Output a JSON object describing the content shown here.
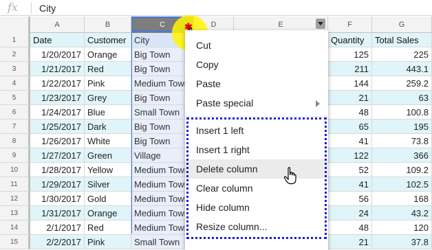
{
  "formula_bar": {
    "fx_label": "fx",
    "value": "City"
  },
  "columns": [
    {
      "letter": "A"
    },
    {
      "letter": "B"
    },
    {
      "letter": "C"
    },
    {
      "letter": "D"
    },
    {
      "letter": "E"
    },
    {
      "letter": "F"
    },
    {
      "letter": "G"
    }
  ],
  "header_row": {
    "number": "1",
    "cells": [
      "Date",
      "Customer",
      "City",
      "Quantity",
      "Total Sales"
    ]
  },
  "rows": [
    {
      "number": "2",
      "date": "1/20/2017",
      "customer": "Orange",
      "city": "Big Town",
      "quantity": "125",
      "total": "225"
    },
    {
      "number": "3",
      "date": "1/21/2017",
      "customer": "Red",
      "city": "Big Town",
      "quantity": "211",
      "total": "443.1"
    },
    {
      "number": "4",
      "date": "1/22/2017",
      "customer": "Pink",
      "city": "Medium Town",
      "quantity": "144",
      "total": "259.2"
    },
    {
      "number": "5",
      "date": "1/23/2017",
      "customer": "Grey",
      "city": "Big Town",
      "quantity": "21",
      "total": "63"
    },
    {
      "number": "6",
      "date": "1/24/2017",
      "customer": "Blue",
      "city": "Small Town",
      "quantity": "48",
      "total": "100.8"
    },
    {
      "number": "7",
      "date": "1/25/2017",
      "customer": "Dark",
      "city": "Big Town",
      "quantity": "65",
      "total": "195"
    },
    {
      "number": "8",
      "date": "1/26/2017",
      "customer": "White",
      "city": "Big Town",
      "quantity": "41",
      "total": "73.8"
    },
    {
      "number": "9",
      "date": "1/27/2017",
      "customer": "Green",
      "city": "Village",
      "quantity": "122",
      "total": "366"
    },
    {
      "number": "10",
      "date": "1/28/2017",
      "customer": "Yellow",
      "city": "Medium Town",
      "quantity": "52",
      "total": "109.2"
    },
    {
      "number": "11",
      "date": "1/29/2017",
      "customer": "Silver",
      "city": "Medium Town",
      "quantity": "41",
      "total": "102.5"
    },
    {
      "number": "12",
      "date": "1/30/2017",
      "customer": "Gold",
      "city": "Medium Town",
      "quantity": "56",
      "total": "168"
    },
    {
      "number": "13",
      "date": "1/31/2017",
      "customer": "Orange",
      "city": "Medium Town",
      "quantity": "24",
      "total": "43.2"
    },
    {
      "number": "14",
      "date": "2/1/2017",
      "customer": "Red",
      "city": "Medium Town",
      "quantity": "48",
      "total": "120"
    },
    {
      "number": "15",
      "date": "2/2/2017",
      "customer": "Pink",
      "city": "Small Town",
      "quantity": "21",
      "total": "37.8"
    }
  ],
  "context_menu": {
    "cut": "Cut",
    "copy": "Copy",
    "paste": "Paste",
    "paste_special": "Paste special",
    "insert_left": "Insert 1 left",
    "insert_right": "Insert 1 right",
    "delete_column": "Delete column",
    "clear_column": "Clear column",
    "hide_column": "Hide column",
    "resize_column": "Resize column..."
  },
  "colors": {
    "header_fill": "#4dd0e1",
    "band_fill": "#e0f5f9",
    "selection": "#4a78d8",
    "highlight": "#fff500",
    "dotted_border": "#1b1bd6"
  }
}
